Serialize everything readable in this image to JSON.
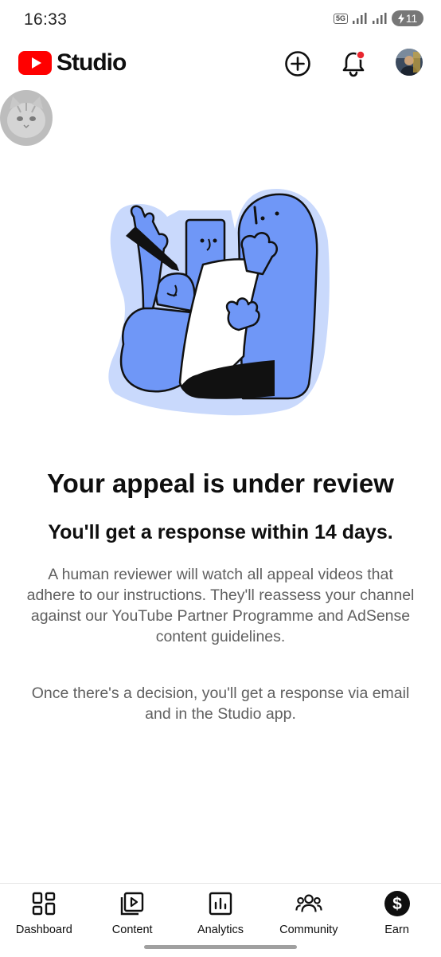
{
  "status_bar": {
    "time": "16:33",
    "network": "5G",
    "battery": "11"
  },
  "header": {
    "logo_text": "Studio"
  },
  "main": {
    "title": "Your appeal is under review",
    "subtitle": "You'll get a response within 14 days.",
    "paragraph_1": "A human reviewer will watch all appeal videos that adhere to our instructions. They'll reassess your channel against our YouTube Partner Programme and AdSense content guidelines.",
    "paragraph_2": "Once there's a decision, you'll get a response via email and in the Studio app."
  },
  "bottom_nav": {
    "items": [
      {
        "label": "Dashboard",
        "icon": "dashboard-icon"
      },
      {
        "label": "Content",
        "icon": "content-icon"
      },
      {
        "label": "Analytics",
        "icon": "analytics-icon"
      },
      {
        "label": "Community",
        "icon": "community-icon"
      },
      {
        "label": "Earn",
        "icon": "dollar-icon"
      }
    ]
  },
  "colors": {
    "brand_red": "#ff0000",
    "illustration_blue": "#6f97f7",
    "illustration_halo": "#c9d9fc",
    "notification_dot": "#e8262f",
    "text_secondary": "#606060"
  }
}
